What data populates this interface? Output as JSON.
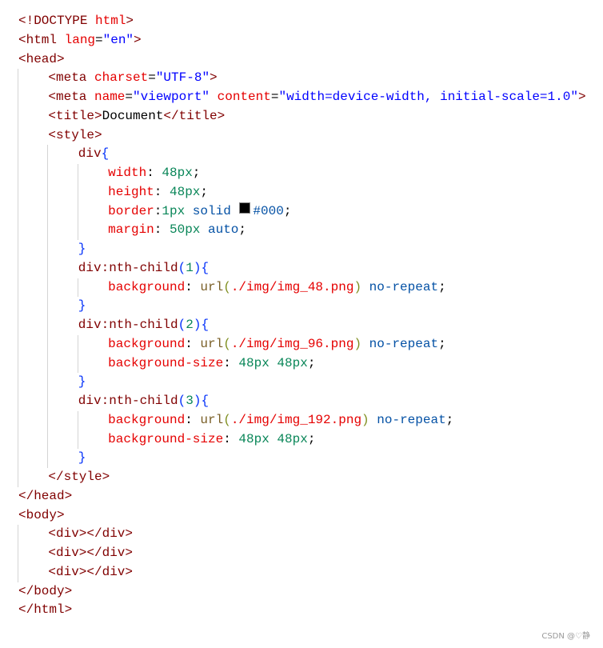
{
  "colors": {
    "tag": "#800000",
    "attr": "#e50000",
    "str": "#0000ff",
    "prop": "#e50000",
    "num": "#098658",
    "kw": "#0451a5",
    "punc": "#000000",
    "brace": "#0431fa",
    "func": "#795e26",
    "paren": "#7f8f1f",
    "text": "#000000",
    "sel": "#800000",
    "path": "#e50000"
  },
  "lines": [
    {
      "indent": 0,
      "tokens": [
        {
          "t": "<!DOCTYPE ",
          "c": "tag"
        },
        {
          "t": "html",
          "c": "attr"
        },
        {
          "t": ">",
          "c": "tag"
        }
      ]
    },
    {
      "indent": 0,
      "tokens": [
        {
          "t": "<html ",
          "c": "tag"
        },
        {
          "t": "lang",
          "c": "attr"
        },
        {
          "t": "=",
          "c": "punc"
        },
        {
          "t": "\"en\"",
          "c": "str"
        },
        {
          "t": ">",
          "c": "tag"
        }
      ]
    },
    {
      "indent": 0,
      "tokens": [
        {
          "t": "<head>",
          "c": "tag"
        }
      ]
    },
    {
      "indent": 1,
      "tokens": [
        {
          "t": "<meta ",
          "c": "tag"
        },
        {
          "t": "charset",
          "c": "attr"
        },
        {
          "t": "=",
          "c": "punc"
        },
        {
          "t": "\"UTF-8\"",
          "c": "str"
        },
        {
          "t": ">",
          "c": "tag"
        }
      ]
    },
    {
      "indent": 1,
      "tokens": [
        {
          "t": "<meta ",
          "c": "tag"
        },
        {
          "t": "name",
          "c": "attr"
        },
        {
          "t": "=",
          "c": "punc"
        },
        {
          "t": "\"viewport\"",
          "c": "str"
        },
        {
          "t": " ",
          "c": "punc"
        },
        {
          "t": "content",
          "c": "attr"
        },
        {
          "t": "=",
          "c": "punc"
        },
        {
          "t": "\"width=device-width, initial-scale=1.0\"",
          "c": "str"
        },
        {
          "t": ">",
          "c": "tag"
        }
      ]
    },
    {
      "indent": 1,
      "tokens": [
        {
          "t": "<title>",
          "c": "tag"
        },
        {
          "t": "Document",
          "c": "text"
        },
        {
          "t": "</title>",
          "c": "tag"
        }
      ]
    },
    {
      "indent": 1,
      "tokens": [
        {
          "t": "<style>",
          "c": "tag"
        }
      ]
    },
    {
      "indent": 2,
      "tokens": [
        {
          "t": "div",
          "c": "sel"
        },
        {
          "t": "{",
          "c": "brace"
        }
      ]
    },
    {
      "indent": 3,
      "tokens": [
        {
          "t": "width",
          "c": "prop"
        },
        {
          "t": ": ",
          "c": "punc"
        },
        {
          "t": "48px",
          "c": "num"
        },
        {
          "t": ";",
          "c": "punc"
        }
      ]
    },
    {
      "indent": 3,
      "tokens": [
        {
          "t": "height",
          "c": "prop"
        },
        {
          "t": ": ",
          "c": "punc"
        },
        {
          "t": "48px",
          "c": "num"
        },
        {
          "t": ";",
          "c": "punc"
        }
      ]
    },
    {
      "indent": 3,
      "tokens": [
        {
          "t": "border",
          "c": "prop"
        },
        {
          "t": ":",
          "c": "punc"
        },
        {
          "t": "1px",
          "c": "num"
        },
        {
          "t": " solid ",
          "c": "kw"
        },
        {
          "swatch": "#000000"
        },
        {
          "t": "#000",
          "c": "kw"
        },
        {
          "t": ";",
          "c": "punc"
        }
      ]
    },
    {
      "indent": 3,
      "tokens": [
        {
          "t": "margin",
          "c": "prop"
        },
        {
          "t": ": ",
          "c": "punc"
        },
        {
          "t": "50px",
          "c": "num"
        },
        {
          "t": " auto",
          "c": "kw"
        },
        {
          "t": ";",
          "c": "punc"
        }
      ]
    },
    {
      "indent": 2,
      "tokens": [
        {
          "t": "}",
          "c": "brace"
        }
      ]
    },
    {
      "indent": 2,
      "tokens": [
        {
          "t": "div:nth-child",
          "c": "sel"
        },
        {
          "t": "(",
          "c": "brace"
        },
        {
          "t": "1",
          "c": "num"
        },
        {
          "t": ")",
          "c": "brace"
        },
        {
          "t": "{",
          "c": "brace"
        }
      ]
    },
    {
      "indent": 3,
      "tokens": [
        {
          "t": "background",
          "c": "prop"
        },
        {
          "t": ": ",
          "c": "punc"
        },
        {
          "t": "url",
          "c": "func"
        },
        {
          "t": "(",
          "c": "paren"
        },
        {
          "t": "./img/img_48.png",
          "c": "path"
        },
        {
          "t": ")",
          "c": "paren"
        },
        {
          "t": " no-repeat",
          "c": "kw"
        },
        {
          "t": ";",
          "c": "punc"
        }
      ]
    },
    {
      "indent": 2,
      "tokens": [
        {
          "t": "}",
          "c": "brace"
        }
      ]
    },
    {
      "indent": 2,
      "tokens": [
        {
          "t": "div:nth-child",
          "c": "sel"
        },
        {
          "t": "(",
          "c": "brace"
        },
        {
          "t": "2",
          "c": "num"
        },
        {
          "t": ")",
          "c": "brace"
        },
        {
          "t": "{",
          "c": "brace"
        }
      ]
    },
    {
      "indent": 3,
      "tokens": [
        {
          "t": "background",
          "c": "prop"
        },
        {
          "t": ": ",
          "c": "punc"
        },
        {
          "t": "url",
          "c": "func"
        },
        {
          "t": "(",
          "c": "paren"
        },
        {
          "t": "./img/img_96.png",
          "c": "path"
        },
        {
          "t": ")",
          "c": "paren"
        },
        {
          "t": " no-repeat",
          "c": "kw"
        },
        {
          "t": ";",
          "c": "punc"
        }
      ]
    },
    {
      "indent": 3,
      "tokens": [
        {
          "t": "background-size",
          "c": "prop"
        },
        {
          "t": ": ",
          "c": "punc"
        },
        {
          "t": "48px 48px",
          "c": "num"
        },
        {
          "t": ";",
          "c": "punc"
        }
      ]
    },
    {
      "indent": 2,
      "tokens": [
        {
          "t": "}",
          "c": "brace"
        }
      ]
    },
    {
      "indent": 2,
      "tokens": [
        {
          "t": "div:nth-child",
          "c": "sel"
        },
        {
          "t": "(",
          "c": "brace"
        },
        {
          "t": "3",
          "c": "num"
        },
        {
          "t": ")",
          "c": "brace"
        },
        {
          "t": "{",
          "c": "brace"
        }
      ]
    },
    {
      "indent": 3,
      "tokens": [
        {
          "t": "background",
          "c": "prop"
        },
        {
          "t": ": ",
          "c": "punc"
        },
        {
          "t": "url",
          "c": "func"
        },
        {
          "t": "(",
          "c": "paren"
        },
        {
          "t": "./img/img_192.png",
          "c": "path"
        },
        {
          "t": ")",
          "c": "paren"
        },
        {
          "t": " no-repeat",
          "c": "kw"
        },
        {
          "t": ";",
          "c": "punc"
        }
      ]
    },
    {
      "indent": 3,
      "tokens": [
        {
          "t": "background-size",
          "c": "prop"
        },
        {
          "t": ": ",
          "c": "punc"
        },
        {
          "t": "48px 48px",
          "c": "num"
        },
        {
          "t": ";",
          "c": "punc"
        }
      ]
    },
    {
      "indent": 2,
      "tokens": [
        {
          "t": "}",
          "c": "brace"
        }
      ]
    },
    {
      "indent": 1,
      "tokens": [
        {
          "t": "</style>",
          "c": "tag"
        }
      ]
    },
    {
      "indent": 0,
      "tokens": [
        {
          "t": "</head>",
          "c": "tag"
        }
      ]
    },
    {
      "indent": 0,
      "tokens": [
        {
          "t": "<body>",
          "c": "tag"
        }
      ]
    },
    {
      "indent": 1,
      "tokens": [
        {
          "t": "<div></div>",
          "c": "tag"
        }
      ]
    },
    {
      "indent": 1,
      "tokens": [
        {
          "t": "<div></div>",
          "c": "tag"
        }
      ]
    },
    {
      "indent": 1,
      "tokens": [
        {
          "t": "<div></div>",
          "c": "tag"
        }
      ]
    },
    {
      "indent": 0,
      "tokens": [
        {
          "t": "</body>",
          "c": "tag"
        }
      ]
    },
    {
      "indent": 0,
      "tokens": [
        {
          "t": "</html>",
          "c": "tag"
        }
      ]
    }
  ],
  "watermark": "CSDN @♡静"
}
